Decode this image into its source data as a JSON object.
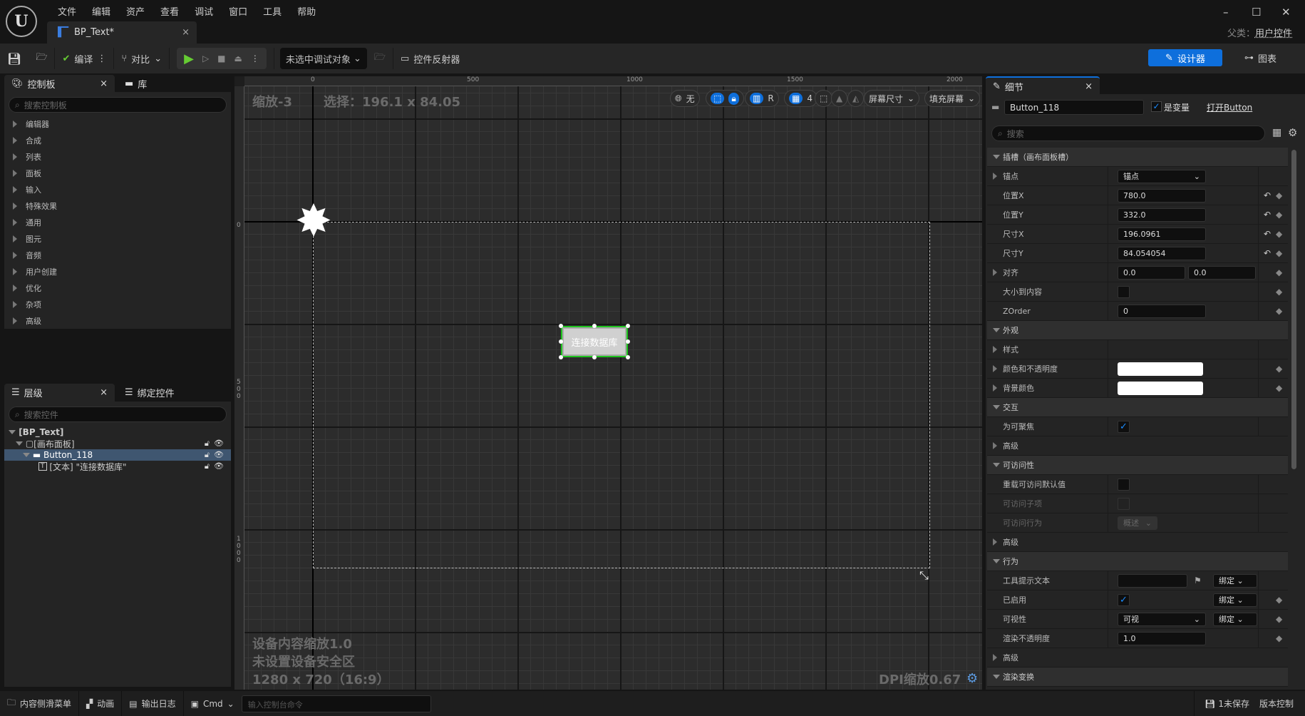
{
  "menu": [
    "文件",
    "编辑",
    "资产",
    "查看",
    "调试",
    "窗口",
    "工具",
    "帮助"
  ],
  "document_tab": {
    "title": "BP_Text*"
  },
  "window": {
    "parent_label": "父类：",
    "parent_value": "用户控件"
  },
  "toolbar": {
    "compile": "编译",
    "diff": "对比",
    "debug_target": "未选中调试对象",
    "widget_reflector": "控件反射器",
    "designer": "设计器",
    "graph": "图表"
  },
  "palette": {
    "tab": "控制板",
    "library_tab": "库",
    "search_placeholder": "搜索控制板",
    "categories": [
      "编辑器",
      "合成",
      "列表",
      "面板",
      "输入",
      "特殊效果",
      "通用",
      "图元",
      "音频",
      "用户创建",
      "优化",
      "杂项",
      "高级"
    ]
  },
  "hierarchy": {
    "tab": "层级",
    "bind_tab": "绑定控件",
    "search_placeholder": "搜索控件",
    "items": [
      {
        "label": "[BP_Text]"
      },
      {
        "label": "[画布面板]"
      },
      {
        "label": "Button_118",
        "selected": true
      },
      {
        "label": "[文本] \"连接数据库\""
      }
    ]
  },
  "canvas": {
    "zoom": "缩放-3",
    "selection": "选择：196.1 x 84.05",
    "ruler_top": [
      "0",
      "500",
      "1000",
      "1500",
      "2000"
    ],
    "ruler_left": [
      "0",
      "500",
      "1000"
    ],
    "button_text": "连接数据库",
    "overlay": [
      "设备内容缩放1.0",
      "未设置设备安全区",
      "1280 x 720（16:9）"
    ],
    "dpi": "DPI缩放0.67",
    "tools": {
      "none": "无",
      "r": "R",
      "grid": "4",
      "screen_size": "屏幕尺寸",
      "fill_screen": "填充屏幕"
    }
  },
  "details": {
    "tab": "细节",
    "name": "Button_118",
    "is_variable": "是变量",
    "is_variable_checked": true,
    "open": "打开Button",
    "search_placeholder": "搜索",
    "rows": [
      {
        "type": "header",
        "label": "插槽（画布面板槽）"
      },
      {
        "label": "锚点",
        "expand": true,
        "dropdown": "锚点"
      },
      {
        "label": "位置X",
        "input": "780.0",
        "reset": true,
        "key": true
      },
      {
        "label": "位置Y",
        "input": "332.0",
        "reset": true,
        "key": true
      },
      {
        "label": "尺寸X",
        "input": "196.0961",
        "reset": true,
        "key": true
      },
      {
        "label": "尺寸Y",
        "input": "84.054054",
        "reset": true,
        "key": true
      },
      {
        "label": "对齐",
        "expand": true,
        "input": "0.0",
        "input2": "0.0",
        "key": true
      },
      {
        "label": "大小到内容",
        "check": false,
        "key": true
      },
      {
        "label": "ZOrder",
        "input": "0",
        "key": true
      },
      {
        "type": "header",
        "label": "外观"
      },
      {
        "label": "样式",
        "expand": true
      },
      {
        "label": "颜色和不透明度",
        "expand": true,
        "color": "#ffffff",
        "key": true
      },
      {
        "label": "背景颜色",
        "expand": true,
        "color": "#ffffff",
        "key": true
      },
      {
        "type": "header",
        "label": "交互"
      },
      {
        "label": "为可聚焦",
        "check": true
      },
      {
        "type": "sub",
        "label": "高级",
        "expand": true
      },
      {
        "type": "header",
        "label": "可访问性"
      },
      {
        "label": "重载可访问默认值",
        "check": false
      },
      {
        "label": "可访问子项",
        "check": false,
        "disabled": true
      },
      {
        "label": "可访问行为",
        "dropdown": "概述",
        "disabled": true
      },
      {
        "type": "sub",
        "label": "高级",
        "expand": true
      },
      {
        "type": "header",
        "label": "行为"
      },
      {
        "label": "工具提示文本",
        "input": "",
        "flag": true,
        "bind": "绑定"
      },
      {
        "label": "已启用",
        "check": true,
        "bind": "绑定",
        "key": true
      },
      {
        "label": "可视性",
        "dropdown": "可视",
        "bind": "绑定",
        "key": true
      },
      {
        "label": "渲染不透明度",
        "input": "1.0",
        "key": true
      },
      {
        "type": "sub",
        "label": "高级",
        "expand": true
      },
      {
        "type": "header",
        "label": "渲染变换"
      }
    ]
  },
  "bottombar": {
    "content_drawer": "内容侧滑菜单",
    "animation": "动画",
    "output_log": "输出日志",
    "cmd": "Cmd",
    "cmd_placeholder": "输入控制台命令",
    "unsaved": "1未保存",
    "source_control": "版本控制"
  },
  "colors": {
    "accent": "#0e6fdc",
    "selection_green": "#1fc41f",
    "hierarchy_selected": "#3f5670"
  }
}
